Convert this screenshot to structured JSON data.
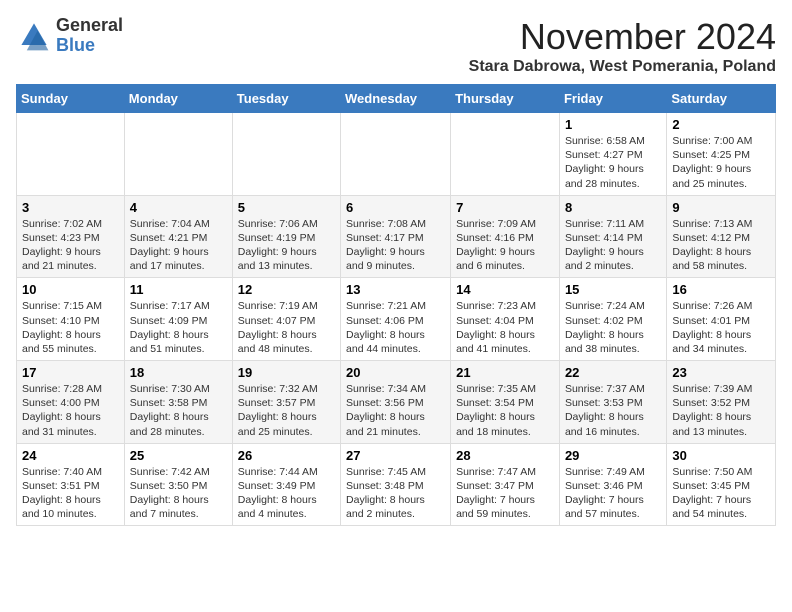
{
  "logo": {
    "general": "General",
    "blue": "Blue"
  },
  "header": {
    "month_year": "November 2024",
    "location": "Stara Dabrowa, West Pomerania, Poland"
  },
  "weekdays": [
    "Sunday",
    "Monday",
    "Tuesday",
    "Wednesday",
    "Thursday",
    "Friday",
    "Saturday"
  ],
  "weeks": [
    [
      {
        "day": "",
        "sunrise": "",
        "sunset": "",
        "daylight": ""
      },
      {
        "day": "",
        "sunrise": "",
        "sunset": "",
        "daylight": ""
      },
      {
        "day": "",
        "sunrise": "",
        "sunset": "",
        "daylight": ""
      },
      {
        "day": "",
        "sunrise": "",
        "sunset": "",
        "daylight": ""
      },
      {
        "day": "",
        "sunrise": "",
        "sunset": "",
        "daylight": ""
      },
      {
        "day": "1",
        "sunrise": "Sunrise: 6:58 AM",
        "sunset": "Sunset: 4:27 PM",
        "daylight": "Daylight: 9 hours and 28 minutes."
      },
      {
        "day": "2",
        "sunrise": "Sunrise: 7:00 AM",
        "sunset": "Sunset: 4:25 PM",
        "daylight": "Daylight: 9 hours and 25 minutes."
      }
    ],
    [
      {
        "day": "3",
        "sunrise": "Sunrise: 7:02 AM",
        "sunset": "Sunset: 4:23 PM",
        "daylight": "Daylight: 9 hours and 21 minutes."
      },
      {
        "day": "4",
        "sunrise": "Sunrise: 7:04 AM",
        "sunset": "Sunset: 4:21 PM",
        "daylight": "Daylight: 9 hours and 17 minutes."
      },
      {
        "day": "5",
        "sunrise": "Sunrise: 7:06 AM",
        "sunset": "Sunset: 4:19 PM",
        "daylight": "Daylight: 9 hours and 13 minutes."
      },
      {
        "day": "6",
        "sunrise": "Sunrise: 7:08 AM",
        "sunset": "Sunset: 4:17 PM",
        "daylight": "Daylight: 9 hours and 9 minutes."
      },
      {
        "day": "7",
        "sunrise": "Sunrise: 7:09 AM",
        "sunset": "Sunset: 4:16 PM",
        "daylight": "Daylight: 9 hours and 6 minutes."
      },
      {
        "day": "8",
        "sunrise": "Sunrise: 7:11 AM",
        "sunset": "Sunset: 4:14 PM",
        "daylight": "Daylight: 9 hours and 2 minutes."
      },
      {
        "day": "9",
        "sunrise": "Sunrise: 7:13 AM",
        "sunset": "Sunset: 4:12 PM",
        "daylight": "Daylight: 8 hours and 58 minutes."
      }
    ],
    [
      {
        "day": "10",
        "sunrise": "Sunrise: 7:15 AM",
        "sunset": "Sunset: 4:10 PM",
        "daylight": "Daylight: 8 hours and 55 minutes."
      },
      {
        "day": "11",
        "sunrise": "Sunrise: 7:17 AM",
        "sunset": "Sunset: 4:09 PM",
        "daylight": "Daylight: 8 hours and 51 minutes."
      },
      {
        "day": "12",
        "sunrise": "Sunrise: 7:19 AM",
        "sunset": "Sunset: 4:07 PM",
        "daylight": "Daylight: 8 hours and 48 minutes."
      },
      {
        "day": "13",
        "sunrise": "Sunrise: 7:21 AM",
        "sunset": "Sunset: 4:06 PM",
        "daylight": "Daylight: 8 hours and 44 minutes."
      },
      {
        "day": "14",
        "sunrise": "Sunrise: 7:23 AM",
        "sunset": "Sunset: 4:04 PM",
        "daylight": "Daylight: 8 hours and 41 minutes."
      },
      {
        "day": "15",
        "sunrise": "Sunrise: 7:24 AM",
        "sunset": "Sunset: 4:02 PM",
        "daylight": "Daylight: 8 hours and 38 minutes."
      },
      {
        "day": "16",
        "sunrise": "Sunrise: 7:26 AM",
        "sunset": "Sunset: 4:01 PM",
        "daylight": "Daylight: 8 hours and 34 minutes."
      }
    ],
    [
      {
        "day": "17",
        "sunrise": "Sunrise: 7:28 AM",
        "sunset": "Sunset: 4:00 PM",
        "daylight": "Daylight: 8 hours and 31 minutes."
      },
      {
        "day": "18",
        "sunrise": "Sunrise: 7:30 AM",
        "sunset": "Sunset: 3:58 PM",
        "daylight": "Daylight: 8 hours and 28 minutes."
      },
      {
        "day": "19",
        "sunrise": "Sunrise: 7:32 AM",
        "sunset": "Sunset: 3:57 PM",
        "daylight": "Daylight: 8 hours and 25 minutes."
      },
      {
        "day": "20",
        "sunrise": "Sunrise: 7:34 AM",
        "sunset": "Sunset: 3:56 PM",
        "daylight": "Daylight: 8 hours and 21 minutes."
      },
      {
        "day": "21",
        "sunrise": "Sunrise: 7:35 AM",
        "sunset": "Sunset: 3:54 PM",
        "daylight": "Daylight: 8 hours and 18 minutes."
      },
      {
        "day": "22",
        "sunrise": "Sunrise: 7:37 AM",
        "sunset": "Sunset: 3:53 PM",
        "daylight": "Daylight: 8 hours and 16 minutes."
      },
      {
        "day": "23",
        "sunrise": "Sunrise: 7:39 AM",
        "sunset": "Sunset: 3:52 PM",
        "daylight": "Daylight: 8 hours and 13 minutes."
      }
    ],
    [
      {
        "day": "24",
        "sunrise": "Sunrise: 7:40 AM",
        "sunset": "Sunset: 3:51 PM",
        "daylight": "Daylight: 8 hours and 10 minutes."
      },
      {
        "day": "25",
        "sunrise": "Sunrise: 7:42 AM",
        "sunset": "Sunset: 3:50 PM",
        "daylight": "Daylight: 8 hours and 7 minutes."
      },
      {
        "day": "26",
        "sunrise": "Sunrise: 7:44 AM",
        "sunset": "Sunset: 3:49 PM",
        "daylight": "Daylight: 8 hours and 4 minutes."
      },
      {
        "day": "27",
        "sunrise": "Sunrise: 7:45 AM",
        "sunset": "Sunset: 3:48 PM",
        "daylight": "Daylight: 8 hours and 2 minutes."
      },
      {
        "day": "28",
        "sunrise": "Sunrise: 7:47 AM",
        "sunset": "Sunset: 3:47 PM",
        "daylight": "Daylight: 7 hours and 59 minutes."
      },
      {
        "day": "29",
        "sunrise": "Sunrise: 7:49 AM",
        "sunset": "Sunset: 3:46 PM",
        "daylight": "Daylight: 7 hours and 57 minutes."
      },
      {
        "day": "30",
        "sunrise": "Sunrise: 7:50 AM",
        "sunset": "Sunset: 3:45 PM",
        "daylight": "Daylight: 7 hours and 54 minutes."
      }
    ]
  ]
}
